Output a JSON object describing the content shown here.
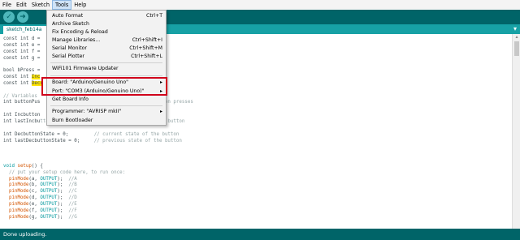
{
  "menubar": [
    "File",
    "Edit",
    "Sketch",
    "Tools",
    "Help"
  ],
  "toolbar": {
    "verify_icon": "check-icon",
    "upload_icon": "arrow-right-icon"
  },
  "tab": {
    "label": "sketch_feb14a"
  },
  "code_lines": [
    [
      {
        "t": "const int d = ",
        "c": ""
      }
    ],
    [
      {
        "t": "const int e = ",
        "c": ""
      }
    ],
    [
      {
        "t": "const int f = ",
        "c": ""
      }
    ],
    [
      {
        "t": "const int g = ",
        "c": ""
      }
    ],
    [
      {
        "t": "",
        "c": ""
      }
    ],
    [
      {
        "t": "bool bPress = ",
        "c": ""
      }
    ],
    [
      {
        "t": "const int ",
        "c": ""
      },
      {
        "t": "Inc",
        "c": "hl"
      }
    ],
    [
      {
        "t": "const int ",
        "c": ""
      },
      {
        "t": "Decr",
        "c": "hl"
      }
    ],
    [
      {
        "t": "",
        "c": ""
      }
    ],
    [
      {
        "t": "// Variables",
        "c": "cm"
      }
    ],
    [
      {
        "t": "int buttonPus",
        "c": ""
      },
      {
        "t": "                                          tton presses",
        "c": "cm"
      }
    ],
    [
      {
        "t": "",
        "c": ""
      }
    ],
    [
      {
        "t": "int Incbutton",
        "c": ""
      },
      {
        "t": "                                         ton",
        "c": "cm"
      }
    ],
    [
      {
        "t": "int lastIncbu",
        "c": ""
      },
      {
        "t": "ttonState = 0;      // previous state of the button",
        "c": "cm"
      }
    ],
    [
      {
        "t": "",
        "c": ""
      }
    ],
    [
      {
        "t": "int DecbuttonState = 0;         ",
        "c": ""
      },
      {
        "t": "// current state of the button",
        "c": "cm"
      }
    ],
    [
      {
        "t": "int lastDecbuttonState = 0;     ",
        "c": ""
      },
      {
        "t": "// previous state of the button",
        "c": "cm"
      }
    ],
    [
      {
        "t": "",
        "c": ""
      }
    ],
    [
      {
        "t": "",
        "c": ""
      }
    ],
    [
      {
        "t": "",
        "c": ""
      }
    ],
    [
      {
        "t": "void ",
        "c": "kw"
      },
      {
        "t": "setup",
        "c": "fn"
      },
      {
        "t": "() {",
        "c": ""
      }
    ],
    [
      {
        "t": "  // put your setup code here, to run once:",
        "c": "cm"
      }
    ],
    [
      {
        "t": "  ",
        "c": ""
      },
      {
        "t": "pinMode",
        "c": "fn"
      },
      {
        "t": "(a, ",
        "c": ""
      },
      {
        "t": "OUTPUT",
        "c": "cn"
      },
      {
        "t": ");  ",
        "c": ""
      },
      {
        "t": "//A",
        "c": "cm"
      }
    ],
    [
      {
        "t": "  ",
        "c": ""
      },
      {
        "t": "pinMode",
        "c": "fn"
      },
      {
        "t": "(b, ",
        "c": ""
      },
      {
        "t": "OUTPUT",
        "c": "cn"
      },
      {
        "t": ");  ",
        "c": ""
      },
      {
        "t": "//B",
        "c": "cm"
      }
    ],
    [
      {
        "t": "  ",
        "c": ""
      },
      {
        "t": "pinMode",
        "c": "fn"
      },
      {
        "t": "(c, ",
        "c": ""
      },
      {
        "t": "OUTPUT",
        "c": "cn"
      },
      {
        "t": ");  ",
        "c": ""
      },
      {
        "t": "//C",
        "c": "cm"
      }
    ],
    [
      {
        "t": "  ",
        "c": ""
      },
      {
        "t": "pinMode",
        "c": "fn"
      },
      {
        "t": "(d, ",
        "c": ""
      },
      {
        "t": "OUTPUT",
        "c": "cn"
      },
      {
        "t": ");  ",
        "c": ""
      },
      {
        "t": "//D",
        "c": "cm"
      }
    ],
    [
      {
        "t": "  ",
        "c": ""
      },
      {
        "t": "pinMode",
        "c": "fn"
      },
      {
        "t": "(e, ",
        "c": ""
      },
      {
        "t": "OUTPUT",
        "c": "cn"
      },
      {
        "t": ");  ",
        "c": ""
      },
      {
        "t": "//E",
        "c": "cm"
      }
    ],
    [
      {
        "t": "  ",
        "c": ""
      },
      {
        "t": "pinMode",
        "c": "fn"
      },
      {
        "t": "(f, ",
        "c": ""
      },
      {
        "t": "OUTPUT",
        "c": "cn"
      },
      {
        "t": ");  ",
        "c": ""
      },
      {
        "t": "//F",
        "c": "cm"
      }
    ],
    [
      {
        "t": "  ",
        "c": ""
      },
      {
        "t": "pinMode",
        "c": "fn"
      },
      {
        "t": "(g, ",
        "c": ""
      },
      {
        "t": "OUTPUT",
        "c": "cn"
      },
      {
        "t": ");  ",
        "c": ""
      },
      {
        "t": "//G",
        "c": "cm"
      }
    ]
  ],
  "tools_menu": {
    "items": [
      {
        "label": "Auto Format",
        "shortcut": "Ctrl+T"
      },
      {
        "label": "Archive Sketch",
        "shortcut": ""
      },
      {
        "label": "Fix Encoding & Reload",
        "shortcut": ""
      },
      {
        "label": "Manage Libraries...",
        "shortcut": "Ctrl+Shift+I"
      },
      {
        "label": "Serial Monitor",
        "shortcut": "Ctrl+Shift+M"
      },
      {
        "label": "Serial Plotter",
        "shortcut": "Ctrl+Shift+L"
      },
      {
        "label": "WiFi101 Firmware Updater",
        "shortcut": ""
      },
      {
        "label": "Board: \"Arduino/Genuino Uno\"",
        "shortcut": "",
        "submenu": true
      },
      {
        "label": "Port: \"COM3 (Arduino/Genuino Uno)\"",
        "shortcut": "",
        "submenu": true
      },
      {
        "label": "Get Board Info",
        "shortcut": ""
      },
      {
        "label": "Programmer: \"AVRISP mkII\"",
        "shortcut": "",
        "submenu": true
      },
      {
        "label": "Burn Bootloader",
        "shortcut": ""
      }
    ]
  },
  "status": {
    "message": "Done uploading."
  },
  "colors": {
    "toolbar": "#006468",
    "tabbar": "#17a1a5",
    "highlight": "#d0021b"
  }
}
